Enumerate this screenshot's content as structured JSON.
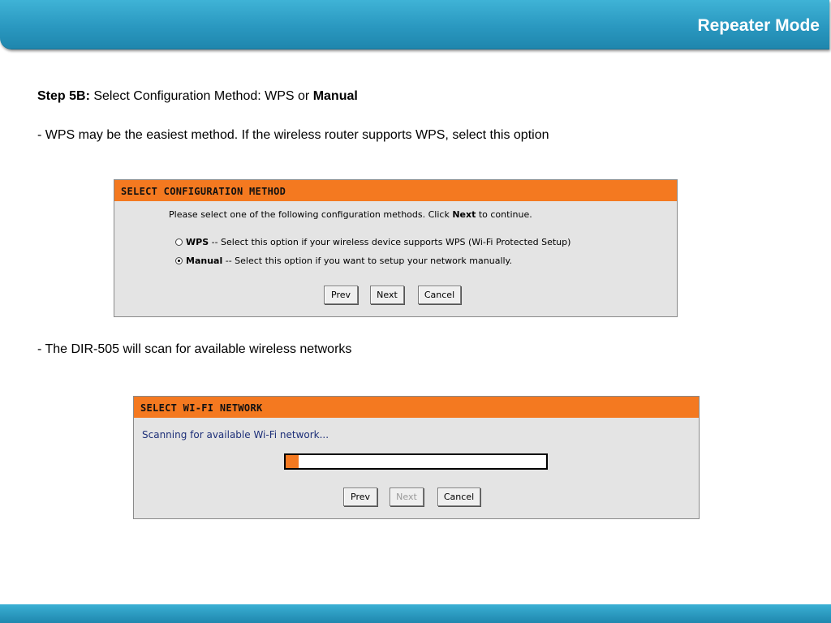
{
  "header": {
    "title": "Repeater Mode"
  },
  "slide": {
    "step_label": "Step 5B:",
    "step_text": " Select Configuration Method: WPS or ",
    "step_bold_end": "Manual",
    "wps_note": "- WPS may be the easiest method. If the wireless router supports WPS, select this option",
    "scan_note": "- The DIR-505 will scan for available wireless networks"
  },
  "config_panel": {
    "title": "SELECT CONFIGURATION METHOD",
    "instruction_pre": "Please select one of the following configuration methods. Click ",
    "instruction_bold": "Next",
    "instruction_post": " to continue.",
    "options": [
      {
        "label": "WPS",
        "description": " -- Select this option if your wireless device supports WPS (Wi-Fi Protected Setup)",
        "selected": false
      },
      {
        "label": "Manual",
        "description": " -- Select this option if you want to setup your network manually.",
        "selected": true
      }
    ],
    "buttons": {
      "prev": "Prev",
      "next": "Next",
      "cancel": "Cancel"
    }
  },
  "wifi_panel": {
    "title": "SELECT WI-FI NETWORK",
    "status": "Scanning for available Wi-Fi network...",
    "progress_fraction": 0.05,
    "buttons": {
      "prev": "Prev",
      "next": "Next",
      "cancel": "Cancel"
    },
    "next_disabled": true
  },
  "colors": {
    "header_blue": "#2a98c0",
    "panel_orange": "#f47920",
    "panel_bg": "#e4e4e4",
    "scan_text": "#1d2f78"
  }
}
